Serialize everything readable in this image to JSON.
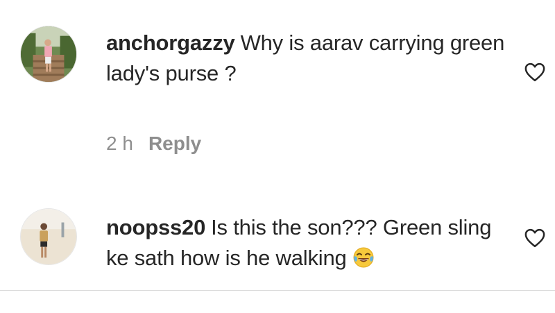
{
  "comments": [
    {
      "username": "anchorgazzy",
      "text": "Why is aarav carrying green lady's purse ?",
      "time": "2 h",
      "reply_label": "Reply",
      "avatar_icon": "user-avatar-photo",
      "like_icon": "heart-outline-icon"
    },
    {
      "username": "noopss20",
      "text": "Is this the son??? Green sling ke sath how is he walking",
      "emoji_icon": "face-with-tears-of-joy-emoji",
      "avatar_icon": "user-avatar-photo",
      "like_icon": "heart-outline-icon"
    }
  ],
  "colors": {
    "text": "#262626",
    "secondary": "#8e8e8e",
    "divider": "#dbdbdb"
  }
}
